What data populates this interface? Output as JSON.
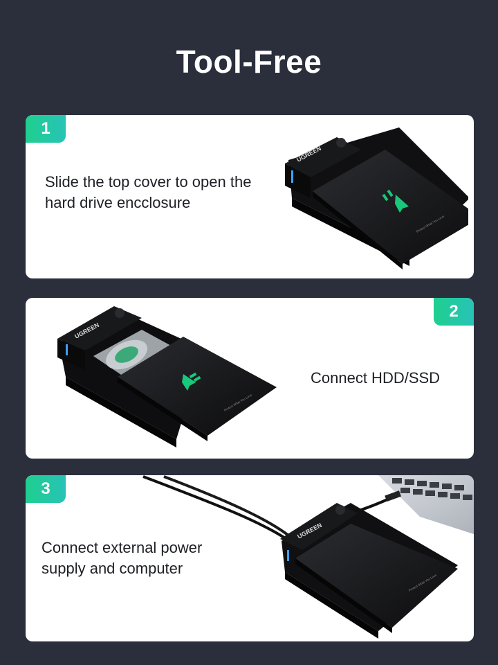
{
  "page": {
    "title": "Tool-Free"
  },
  "steps": [
    {
      "number": "1",
      "text": "Slide the top cover to open the hard drive encclosure"
    },
    {
      "number": "2",
      "text": "Connect HDD/SSD"
    },
    {
      "number": "3",
      "text": "Connect external power supply and computer"
    }
  ],
  "colors": {
    "background": "#2b2f3c",
    "badge_gradient_start": "#1fcf8f",
    "badge_gradient_end": "#28c3b6",
    "card": "#ffffff",
    "arrow": "#19c87a"
  },
  "illustrations": {
    "enclosure_logo": "UGREEN",
    "enclosure_tagline": "Protect What You Love"
  }
}
